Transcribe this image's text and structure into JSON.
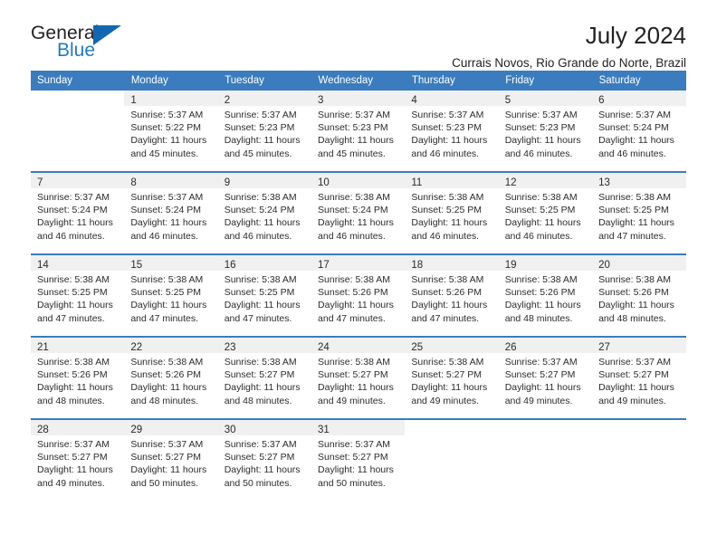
{
  "brand": {
    "name_part1": "General",
    "name_part2": "Blue"
  },
  "header": {
    "title": "July 2024",
    "subtitle": "Currais Novos, Rio Grande do Norte, Brazil"
  },
  "colors": {
    "header_blue": "#3a7cbe",
    "brand_blue": "#1167b1",
    "daynum_band": "#f0f0f0",
    "text": "#2b2b2b"
  },
  "weekdays": [
    "Sunday",
    "Monday",
    "Tuesday",
    "Wednesday",
    "Thursday",
    "Friday",
    "Saturday"
  ],
  "weeks": [
    [
      {
        "day": "",
        "sunrise": "",
        "sunset": "",
        "daylight1": "",
        "daylight2": ""
      },
      {
        "day": "1",
        "sunrise": "Sunrise: 5:37 AM",
        "sunset": "Sunset: 5:22 PM",
        "daylight1": "Daylight: 11 hours",
        "daylight2": "and 45 minutes."
      },
      {
        "day": "2",
        "sunrise": "Sunrise: 5:37 AM",
        "sunset": "Sunset: 5:23 PM",
        "daylight1": "Daylight: 11 hours",
        "daylight2": "and 45 minutes."
      },
      {
        "day": "3",
        "sunrise": "Sunrise: 5:37 AM",
        "sunset": "Sunset: 5:23 PM",
        "daylight1": "Daylight: 11 hours",
        "daylight2": "and 45 minutes."
      },
      {
        "day": "4",
        "sunrise": "Sunrise: 5:37 AM",
        "sunset": "Sunset: 5:23 PM",
        "daylight1": "Daylight: 11 hours",
        "daylight2": "and 46 minutes."
      },
      {
        "day": "5",
        "sunrise": "Sunrise: 5:37 AM",
        "sunset": "Sunset: 5:23 PM",
        "daylight1": "Daylight: 11 hours",
        "daylight2": "and 46 minutes."
      },
      {
        "day": "6",
        "sunrise": "Sunrise: 5:37 AM",
        "sunset": "Sunset: 5:24 PM",
        "daylight1": "Daylight: 11 hours",
        "daylight2": "and 46 minutes."
      }
    ],
    [
      {
        "day": "7",
        "sunrise": "Sunrise: 5:37 AM",
        "sunset": "Sunset: 5:24 PM",
        "daylight1": "Daylight: 11 hours",
        "daylight2": "and 46 minutes."
      },
      {
        "day": "8",
        "sunrise": "Sunrise: 5:37 AM",
        "sunset": "Sunset: 5:24 PM",
        "daylight1": "Daylight: 11 hours",
        "daylight2": "and 46 minutes."
      },
      {
        "day": "9",
        "sunrise": "Sunrise: 5:38 AM",
        "sunset": "Sunset: 5:24 PM",
        "daylight1": "Daylight: 11 hours",
        "daylight2": "and 46 minutes."
      },
      {
        "day": "10",
        "sunrise": "Sunrise: 5:38 AM",
        "sunset": "Sunset: 5:24 PM",
        "daylight1": "Daylight: 11 hours",
        "daylight2": "and 46 minutes."
      },
      {
        "day": "11",
        "sunrise": "Sunrise: 5:38 AM",
        "sunset": "Sunset: 5:25 PM",
        "daylight1": "Daylight: 11 hours",
        "daylight2": "and 46 minutes."
      },
      {
        "day": "12",
        "sunrise": "Sunrise: 5:38 AM",
        "sunset": "Sunset: 5:25 PM",
        "daylight1": "Daylight: 11 hours",
        "daylight2": "and 46 minutes."
      },
      {
        "day": "13",
        "sunrise": "Sunrise: 5:38 AM",
        "sunset": "Sunset: 5:25 PM",
        "daylight1": "Daylight: 11 hours",
        "daylight2": "and 47 minutes."
      }
    ],
    [
      {
        "day": "14",
        "sunrise": "Sunrise: 5:38 AM",
        "sunset": "Sunset: 5:25 PM",
        "daylight1": "Daylight: 11 hours",
        "daylight2": "and 47 minutes."
      },
      {
        "day": "15",
        "sunrise": "Sunrise: 5:38 AM",
        "sunset": "Sunset: 5:25 PM",
        "daylight1": "Daylight: 11 hours",
        "daylight2": "and 47 minutes."
      },
      {
        "day": "16",
        "sunrise": "Sunrise: 5:38 AM",
        "sunset": "Sunset: 5:25 PM",
        "daylight1": "Daylight: 11 hours",
        "daylight2": "and 47 minutes."
      },
      {
        "day": "17",
        "sunrise": "Sunrise: 5:38 AM",
        "sunset": "Sunset: 5:26 PM",
        "daylight1": "Daylight: 11 hours",
        "daylight2": "and 47 minutes."
      },
      {
        "day": "18",
        "sunrise": "Sunrise: 5:38 AM",
        "sunset": "Sunset: 5:26 PM",
        "daylight1": "Daylight: 11 hours",
        "daylight2": "and 47 minutes."
      },
      {
        "day": "19",
        "sunrise": "Sunrise: 5:38 AM",
        "sunset": "Sunset: 5:26 PM",
        "daylight1": "Daylight: 11 hours",
        "daylight2": "and 48 minutes."
      },
      {
        "day": "20",
        "sunrise": "Sunrise: 5:38 AM",
        "sunset": "Sunset: 5:26 PM",
        "daylight1": "Daylight: 11 hours",
        "daylight2": "and 48 minutes."
      }
    ],
    [
      {
        "day": "21",
        "sunrise": "Sunrise: 5:38 AM",
        "sunset": "Sunset: 5:26 PM",
        "daylight1": "Daylight: 11 hours",
        "daylight2": "and 48 minutes."
      },
      {
        "day": "22",
        "sunrise": "Sunrise: 5:38 AM",
        "sunset": "Sunset: 5:26 PM",
        "daylight1": "Daylight: 11 hours",
        "daylight2": "and 48 minutes."
      },
      {
        "day": "23",
        "sunrise": "Sunrise: 5:38 AM",
        "sunset": "Sunset: 5:27 PM",
        "daylight1": "Daylight: 11 hours",
        "daylight2": "and 48 minutes."
      },
      {
        "day": "24",
        "sunrise": "Sunrise: 5:38 AM",
        "sunset": "Sunset: 5:27 PM",
        "daylight1": "Daylight: 11 hours",
        "daylight2": "and 49 minutes."
      },
      {
        "day": "25",
        "sunrise": "Sunrise: 5:38 AM",
        "sunset": "Sunset: 5:27 PM",
        "daylight1": "Daylight: 11 hours",
        "daylight2": "and 49 minutes."
      },
      {
        "day": "26",
        "sunrise": "Sunrise: 5:37 AM",
        "sunset": "Sunset: 5:27 PM",
        "daylight1": "Daylight: 11 hours",
        "daylight2": "and 49 minutes."
      },
      {
        "day": "27",
        "sunrise": "Sunrise: 5:37 AM",
        "sunset": "Sunset: 5:27 PM",
        "daylight1": "Daylight: 11 hours",
        "daylight2": "and 49 minutes."
      }
    ],
    [
      {
        "day": "28",
        "sunrise": "Sunrise: 5:37 AM",
        "sunset": "Sunset: 5:27 PM",
        "daylight1": "Daylight: 11 hours",
        "daylight2": "and 49 minutes."
      },
      {
        "day": "29",
        "sunrise": "Sunrise: 5:37 AM",
        "sunset": "Sunset: 5:27 PM",
        "daylight1": "Daylight: 11 hours",
        "daylight2": "and 50 minutes."
      },
      {
        "day": "30",
        "sunrise": "Sunrise: 5:37 AM",
        "sunset": "Sunset: 5:27 PM",
        "daylight1": "Daylight: 11 hours",
        "daylight2": "and 50 minutes."
      },
      {
        "day": "31",
        "sunrise": "Sunrise: 5:37 AM",
        "sunset": "Sunset: 5:27 PM",
        "daylight1": "Daylight: 11 hours",
        "daylight2": "and 50 minutes."
      },
      {
        "day": "",
        "sunrise": "",
        "sunset": "",
        "daylight1": "",
        "daylight2": ""
      },
      {
        "day": "",
        "sunrise": "",
        "sunset": "",
        "daylight1": "",
        "daylight2": ""
      },
      {
        "day": "",
        "sunrise": "",
        "sunset": "",
        "daylight1": "",
        "daylight2": ""
      }
    ]
  ]
}
